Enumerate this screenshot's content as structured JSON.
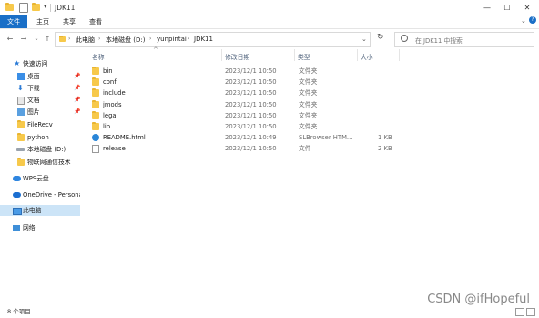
{
  "window": {
    "title": "JDK11"
  },
  "ribbon": {
    "tabs": [
      "文件",
      "主页",
      "共享",
      "查看"
    ]
  },
  "address": {
    "crumbs": [
      "此电脑",
      "本地磁盘 (D:)",
      "yunpintai",
      "JDK11"
    ],
    "search_placeholder": "在 JDK11 中搜索"
  },
  "sidebar": {
    "items": [
      {
        "label": "快速访问",
        "icon": "star-icon"
      },
      {
        "label": "桌面",
        "icon": "desktop-icon",
        "pinned": true
      },
      {
        "label": "下载",
        "icon": "download-icon",
        "pinned": true
      },
      {
        "label": "文档",
        "icon": "document-icon",
        "pinned": true
      },
      {
        "label": "图片",
        "icon": "picture-icon",
        "pinned": true
      },
      {
        "label": "FileRecv",
        "icon": "folder-icon"
      },
      {
        "label": "python",
        "icon": "folder-icon"
      },
      {
        "label": "本地磁盘 (D:)",
        "icon": "drive-icon"
      },
      {
        "label": "物联网通信技术",
        "icon": "folder-icon"
      },
      {
        "label": "WPS云盘",
        "icon": "cloud-icon"
      },
      {
        "label": "OneDrive - Persona",
        "icon": "cloud-icon"
      },
      {
        "label": "此电脑",
        "icon": "pc-icon",
        "selected": true
      },
      {
        "label": "网络",
        "icon": "network-icon"
      }
    ]
  },
  "columns": {
    "name": "名称",
    "date": "修改日期",
    "type": "类型",
    "size": "大小"
  },
  "files": [
    {
      "name": "bin",
      "date": "2023/12/1 10:50",
      "type": "文件夹",
      "size": "",
      "kind": "folder"
    },
    {
      "name": "conf",
      "date": "2023/12/1 10:50",
      "type": "文件夹",
      "size": "",
      "kind": "folder"
    },
    {
      "name": "include",
      "date": "2023/12/1 10:50",
      "type": "文件夹",
      "size": "",
      "kind": "folder"
    },
    {
      "name": "jmods",
      "date": "2023/12/1 10:50",
      "type": "文件夹",
      "size": "",
      "kind": "folder"
    },
    {
      "name": "legal",
      "date": "2023/12/1 10:50",
      "type": "文件夹",
      "size": "",
      "kind": "folder"
    },
    {
      "name": "lib",
      "date": "2023/12/1 10:50",
      "type": "文件夹",
      "size": "",
      "kind": "folder"
    },
    {
      "name": "README.html",
      "date": "2023/12/1 10:49",
      "type": "SLBrowser HTM...",
      "size": "1 KB",
      "kind": "html"
    },
    {
      "name": "release",
      "date": "2023/12/1 10:50",
      "type": "文件",
      "size": "2 KB",
      "kind": "file"
    }
  ],
  "status": {
    "item_count": "8 个项目"
  },
  "watermark": "CSDN @ifHopeful",
  "colors": {
    "accent": "#1a6fc7",
    "selected_bg": "#cce4f7",
    "folder": "#f7c94b"
  }
}
